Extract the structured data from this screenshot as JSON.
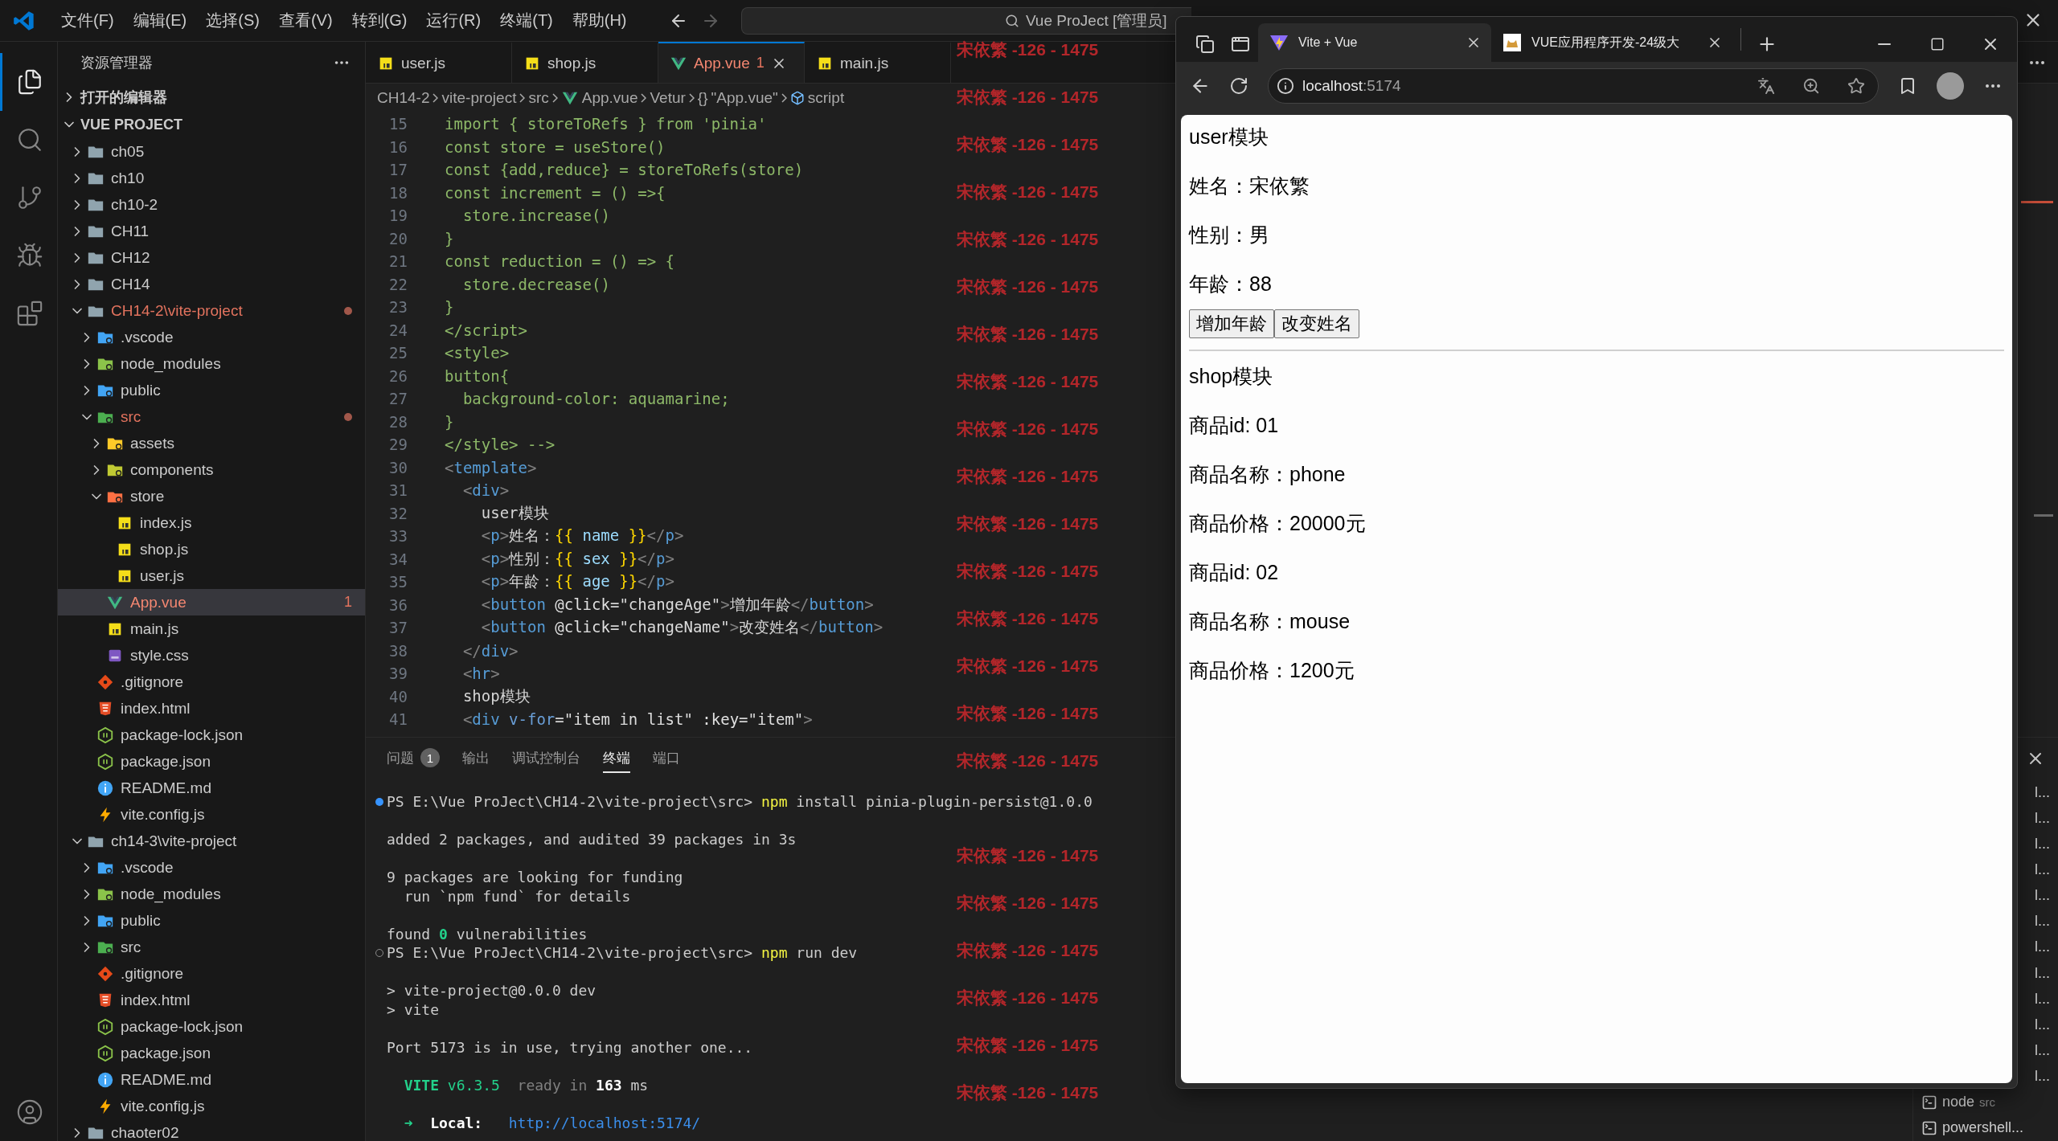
{
  "title_bar": {
    "menus": [
      "文件(F)",
      "编辑(E)",
      "选择(S)",
      "查看(V)",
      "转到(G)",
      "运行(R)",
      "终端(T)",
      "帮助(H)"
    ],
    "search": "Vue ProJect [管理员]"
  },
  "activity_bar": [
    {
      "kind": "explorer",
      "selected": true
    },
    {
      "kind": "search",
      "selected": false
    },
    {
      "kind": "source-control",
      "selected": false
    },
    {
      "kind": "run",
      "selected": false
    },
    {
      "kind": "extensions",
      "selected": false
    }
  ],
  "explorer": {
    "title": "资源管理器",
    "open_editors": "打开的编辑器",
    "root": "VUE PROJECT",
    "tree": [
      {
        "name": "ch05",
        "kind": "folder",
        "expanded": false,
        "modified": false,
        "error": false,
        "selected": false
      },
      {
        "name": "ch10",
        "kind": "folder",
        "expanded": false,
        "modified": false,
        "error": false,
        "selected": false
      },
      {
        "name": "ch10-2",
        "kind": "folder",
        "expanded": false,
        "modified": false,
        "error": false,
        "selected": false
      },
      {
        "name": "CH11",
        "kind": "folder",
        "expanded": false,
        "modified": false,
        "error": false,
        "selected": false
      },
      {
        "name": "CH12",
        "kind": "folder",
        "expanded": false,
        "modified": false,
        "error": false,
        "selected": false
      },
      {
        "name": "CH14",
        "kind": "folder",
        "expanded": false,
        "modified": false,
        "error": false,
        "selected": false
      },
      {
        "name": "CH14-2\\vite-project",
        "kind": "folder",
        "expanded": true,
        "modified": true,
        "error": false,
        "selected": false,
        "children": [
          {
            "name": ".vscode",
            "kind": "vscode",
            "expanded": false,
            "modified": false,
            "error": false,
            "selected": false
          },
          {
            "name": "node_modules",
            "kind": "node",
            "expanded": false,
            "modified": false,
            "error": false,
            "selected": false
          },
          {
            "name": "public",
            "kind": "public",
            "expanded": false,
            "modified": false,
            "error": false,
            "selected": false
          },
          {
            "name": "src",
            "kind": "src",
            "expanded": true,
            "modified": true,
            "error": false,
            "selected": false,
            "children": [
              {
                "name": "assets",
                "kind": "assets",
                "expanded": false,
                "modified": false,
                "error": false,
                "selected": false
              },
              {
                "name": "components",
                "kind": "components",
                "expanded": false,
                "modified": false,
                "error": false,
                "selected": false
              },
              {
                "name": "store",
                "kind": "store",
                "expanded": true,
                "modified": false,
                "error": false,
                "selected": false,
                "children": [
                  {
                    "name": "index.js",
                    "kind": "js",
                    "modified": false,
                    "error": false,
                    "selected": false
                  },
                  {
                    "name": "shop.js",
                    "kind": "js",
                    "modified": false,
                    "error": false,
                    "selected": false
                  },
                  {
                    "name": "user.js",
                    "kind": "js",
                    "modified": false,
                    "error": false,
                    "selected": false
                  }
                ]
              },
              {
                "name": "App.vue",
                "kind": "vue",
                "modified": false,
                "error": true,
                "selected": true,
                "badge": "1"
              },
              {
                "name": "main.js",
                "kind": "js",
                "modified": false,
                "error": false,
                "selected": false
              },
              {
                "name": "style.css",
                "kind": "css",
                "modified": false,
                "error": false,
                "selected": false
              }
            ]
          },
          {
            "name": ".gitignore",
            "kind": "git",
            "modified": false,
            "error": false,
            "selected": false
          },
          {
            "name": "index.html",
            "kind": "html",
            "modified": false,
            "error": false,
            "selected": false
          },
          {
            "name": "package-lock.json",
            "kind": "json",
            "modified": false,
            "error": false,
            "selected": false
          },
          {
            "name": "package.json",
            "kind": "json",
            "modified": false,
            "error": false,
            "selected": false
          },
          {
            "name": "README.md",
            "kind": "info",
            "modified": false,
            "error": false,
            "selected": false
          },
          {
            "name": "vite.config.js",
            "kind": "vite",
            "modified": false,
            "error": false,
            "selected": false
          }
        ]
      },
      {
        "name": "ch14-3\\vite-project",
        "kind": "folder",
        "expanded": true,
        "modified": false,
        "error": false,
        "selected": false,
        "children": [
          {
            "name": ".vscode",
            "kind": "vscode",
            "expanded": false,
            "modified": false,
            "error": false,
            "selected": false
          },
          {
            "name": "node_modules",
            "kind": "node",
            "expanded": false,
            "modified": false,
            "error": false,
            "selected": false
          },
          {
            "name": "public",
            "kind": "public",
            "expanded": false,
            "modified": false,
            "error": false,
            "selected": false
          },
          {
            "name": "src",
            "kind": "src",
            "expanded": false,
            "modified": false,
            "error": false,
            "selected": false
          },
          {
            "name": ".gitignore",
            "kind": "git",
            "modified": false,
            "error": false,
            "selected": false
          },
          {
            "name": "index.html",
            "kind": "html",
            "modified": false,
            "error": false,
            "selected": false
          },
          {
            "name": "package-lock.json",
            "kind": "json",
            "modified": false,
            "error": false,
            "selected": false
          },
          {
            "name": "package.json",
            "kind": "json",
            "modified": false,
            "error": false,
            "selected": false
          },
          {
            "name": "README.md",
            "kind": "info",
            "modified": false,
            "error": false,
            "selected": false
          },
          {
            "name": "vite.config.js",
            "kind": "vite",
            "modified": false,
            "error": false,
            "selected": false
          }
        ]
      },
      {
        "name": "chaoter02",
        "kind": "folder",
        "expanded": false,
        "modified": false,
        "error": false,
        "selected": false
      }
    ]
  },
  "editor_tabs": [
    {
      "label": "user.js",
      "kind": "js",
      "selected": false,
      "error": false
    },
    {
      "label": "shop.js",
      "kind": "js",
      "selected": false,
      "error": false
    },
    {
      "label": "App.vue",
      "kind": "vue",
      "selected": true,
      "error": true,
      "badge": "1"
    },
    {
      "label": "main.js",
      "kind": "js",
      "selected": false,
      "error": false
    }
  ],
  "breadcrumb": [
    {
      "label": "CH14-2",
      "kind": "plain"
    },
    {
      "label": "vite-project",
      "kind": "plain"
    },
    {
      "label": "src",
      "kind": "plain"
    },
    {
      "label": "App.vue",
      "kind": "vue"
    },
    {
      "label": "Vetur",
      "kind": "plain"
    },
    {
      "label": "\"App.vue\"",
      "kind": "object",
      "symbol": "{}"
    },
    {
      "label": "script",
      "kind": "module"
    }
  ],
  "code": [
    {
      "number": "15",
      "tokens": [
        {
          "text": "import { storeToRefs } from 'pinia'",
          "kind": "comment"
        }
      ]
    },
    {
      "number": "16",
      "tokens": [
        {
          "text": "const store = useStore()",
          "kind": "comment"
        }
      ]
    },
    {
      "number": "17",
      "tokens": [
        {
          "text": "const {add,reduce} = storeToRefs(store)",
          "kind": "comment"
        }
      ]
    },
    {
      "number": "18",
      "tokens": [
        {
          "text": "const increment = () =>{",
          "kind": "comment"
        }
      ]
    },
    {
      "number": "19",
      "tokens": [
        {
          "text": "  store.increase()",
          "kind": "comment"
        }
      ]
    },
    {
      "number": "20",
      "tokens": [
        {
          "text": "}",
          "kind": "comment"
        }
      ]
    },
    {
      "number": "21",
      "tokens": [
        {
          "text": "const reduction = () => {",
          "kind": "comment"
        }
      ]
    },
    {
      "number": "22",
      "tokens": [
        {
          "text": "  store.decrease()",
          "kind": "comment"
        }
      ]
    },
    {
      "number": "23",
      "tokens": [
        {
          "text": "}",
          "kind": "comment"
        }
      ]
    },
    {
      "number": "24",
      "tokens": [
        {
          "text": "</script>",
          "kind": "comment"
        }
      ]
    },
    {
      "number": "25",
      "tokens": [
        {
          "text": "<style>",
          "kind": "comment"
        }
      ]
    },
    {
      "number": "26",
      "tokens": [
        {
          "text": "button{",
          "kind": "comment"
        }
      ]
    },
    {
      "number": "27",
      "tokens": [
        {
          "text": "  background-color: aquamarine;",
          "kind": "comment"
        }
      ]
    },
    {
      "number": "28",
      "tokens": [
        {
          "text": "}",
          "kind": "comment"
        }
      ]
    },
    {
      "number": "29",
      "tokens": [
        {
          "text": "</style> -->",
          "kind": "comment"
        }
      ]
    },
    {
      "number": "30",
      "tokens": [
        {
          "text": "<",
          "kind": "punct"
        },
        {
          "text": "template",
          "kind": "tag"
        },
        {
          "text": ">",
          "kind": "punct"
        }
      ]
    },
    {
      "number": "31",
      "tokens": [
        {
          "text": "  <",
          "kind": "punct"
        },
        {
          "text": "div",
          "kind": "tag"
        },
        {
          "text": ">",
          "kind": "punct"
        }
      ]
    },
    {
      "number": "32",
      "tokens": [
        {
          "text": "    user模块",
          "kind": "text"
        }
      ]
    },
    {
      "number": "33",
      "tokens": [
        {
          "text": "    <",
          "kind": "punct"
        },
        {
          "text": "p",
          "kind": "tag"
        },
        {
          "text": ">",
          "kind": "punct"
        },
        {
          "text": "姓名：",
          "kind": "text"
        },
        {
          "text": "{{",
          "kind": "brace"
        },
        {
          "text": " name ",
          "kind": "var"
        },
        {
          "text": "}}",
          "kind": "brace"
        },
        {
          "text": "</",
          "kind": "punct"
        },
        {
          "text": "p",
          "kind": "tag"
        },
        {
          "text": ">",
          "kind": "punct"
        }
      ]
    },
    {
      "number": "34",
      "tokens": [
        {
          "text": "    <",
          "kind": "punct"
        },
        {
          "text": "p",
          "kind": "tag"
        },
        {
          "text": ">",
          "kind": "punct"
        },
        {
          "text": "性别：",
          "kind": "text"
        },
        {
          "text": "{{",
          "kind": "brace"
        },
        {
          "text": " sex ",
          "kind": "var"
        },
        {
          "text": "}}",
          "kind": "brace"
        },
        {
          "text": "</",
          "kind": "punct"
        },
        {
          "text": "p",
          "kind": "tag"
        },
        {
          "text": ">",
          "kind": "punct"
        }
      ]
    },
    {
      "number": "35",
      "tokens": [
        {
          "text": "    <",
          "kind": "punct"
        },
        {
          "text": "p",
          "kind": "tag"
        },
        {
          "text": ">",
          "kind": "punct"
        },
        {
          "text": "年龄：",
          "kind": "text"
        },
        {
          "text": "{{",
          "kind": "brace"
        },
        {
          "text": " age ",
          "kind": "var"
        },
        {
          "text": "}}",
          "kind": "brace"
        },
        {
          "text": "</",
          "kind": "punct"
        },
        {
          "text": "p",
          "kind": "tag"
        },
        {
          "text": ">",
          "kind": "punct"
        }
      ]
    },
    {
      "number": "36",
      "tokens": [
        {
          "text": "    <",
          "kind": "punct"
        },
        {
          "text": "button",
          "kind": "tag"
        },
        {
          "text": " @click",
          "kind": "attr"
        },
        {
          "text": "=",
          "kind": "text"
        },
        {
          "text": "\"changeAge\"",
          "kind": "string"
        },
        {
          "text": ">",
          "kind": "punct"
        },
        {
          "text": "增加年龄",
          "kind": "text"
        },
        {
          "text": "</",
          "kind": "punct"
        },
        {
          "text": "button",
          "kind": "tag"
        },
        {
          "text": ">",
          "kind": "punct"
        }
      ]
    },
    {
      "number": "37",
      "tokens": [
        {
          "text": "    <",
          "kind": "punct"
        },
        {
          "text": "button",
          "kind": "tag"
        },
        {
          "text": " @click",
          "kind": "attr"
        },
        {
          "text": "=",
          "kind": "text"
        },
        {
          "text": "\"changeName\"",
          "kind": "string"
        },
        {
          "text": ">",
          "kind": "punct"
        },
        {
          "text": "改变姓名",
          "kind": "text"
        },
        {
          "text": "</",
          "kind": "punct"
        },
        {
          "text": "button",
          "kind": "tag"
        },
        {
          "text": ">",
          "kind": "punct"
        }
      ]
    },
    {
      "number": "38",
      "tokens": [
        {
          "text": "  </",
          "kind": "punct"
        },
        {
          "text": "div",
          "kind": "tag"
        },
        {
          "text": ">",
          "kind": "punct"
        }
      ]
    },
    {
      "number": "39",
      "tokens": [
        {
          "text": "  <",
          "kind": "punct"
        },
        {
          "text": "hr",
          "kind": "tag"
        },
        {
          "text": ">",
          "kind": "punct"
        }
      ]
    },
    {
      "number": "40",
      "tokens": [
        {
          "text": "  shop模块",
          "kind": "text"
        }
      ]
    },
    {
      "number": "41",
      "tokens": [
        {
          "text": "  <",
          "kind": "punct"
        },
        {
          "text": "div",
          "kind": "tag"
        },
        {
          "text": " v-for",
          "kind": "directive"
        },
        {
          "text": "=",
          "kind": "text"
        },
        {
          "text": "\"item in list\"",
          "kind": "string"
        },
        {
          "text": " :key",
          "kind": "attr"
        },
        {
          "text": "=",
          "kind": "text"
        },
        {
          "text": "\"item\"",
          "kind": "string"
        },
        {
          "text": ">",
          "kind": "punct"
        }
      ]
    }
  ],
  "panel_tabs": [
    {
      "label": "问题",
      "selected": false,
      "badge": "1"
    },
    {
      "label": "输出",
      "selected": false
    },
    {
      "label": "调试控制台",
      "selected": false
    },
    {
      "label": "终端",
      "selected": true
    },
    {
      "label": "端口",
      "selected": false
    }
  ],
  "terminal": {
    "blocks": [
      {
        "lines": [
          {
            "prompt": true,
            "finished": true,
            "segments": [
              {
                "text": "PS E:\\Vue ProJect\\CH14-2\\vite-project\\src> ",
                "kind": "plain"
              },
              {
                "text": "npm",
                "kind": "cmd"
              },
              {
                "text": " install pinia-plugin-persist@1.0.0",
                "kind": "plain"
              }
            ]
          }
        ]
      },
      {
        "lines": [
          {
            "prompt": false,
            "segments": [
              {
                "text": "added 2 packages, and audited 39 packages in 3s",
                "kind": "plain"
              }
            ]
          }
        ]
      },
      {
        "lines": [
          {
            "prompt": false,
            "segments": [
              {
                "text": "9 packages are looking for funding",
                "kind": "plain"
              }
            ]
          },
          {
            "prompt": false,
            "segments": [
              {
                "text": "  run `npm fund` for details",
                "kind": "plain"
              }
            ]
          }
        ]
      },
      {
        "lines": [
          {
            "prompt": false,
            "segments": [
              {
                "text": "found ",
                "kind": "plain"
              },
              {
                "text": "0",
                "kind": "good"
              },
              {
                "text": " vulnerabilities",
                "kind": "plain"
              }
            ]
          },
          {
            "prompt": true,
            "finished": false,
            "segments": [
              {
                "text": "PS E:\\Vue ProJect\\CH14-2\\vite-project\\src> ",
                "kind": "plain"
              },
              {
                "text": "npm",
                "kind": "cmd"
              },
              {
                "text": " run dev",
                "kind": "plain"
              }
            ]
          }
        ]
      },
      {
        "lines": [
          {
            "prompt": false,
            "segments": [
              {
                "text": "> vite-project@0.0.0 dev",
                "kind": "plain"
              }
            ]
          },
          {
            "prompt": false,
            "segments": [
              {
                "text": "> vite",
                "kind": "plain"
              }
            ]
          }
        ]
      },
      {
        "lines": [
          {
            "prompt": false,
            "segments": [
              {
                "text": "Port 5173 is in use, trying another one...",
                "kind": "plain"
              }
            ]
          }
        ]
      },
      {
        "lines": [
          {
            "prompt": false,
            "segments": [
              {
                "text": "  VITE",
                "kind": "good"
              },
              {
                "text": " v6.3.5",
                "kind": "green"
              },
              {
                "text": "  ready in ",
                "kind": "dim"
              },
              {
                "text": "163",
                "kind": "bold"
              },
              {
                "text": " ms",
                "kind": "plain"
              }
            ]
          }
        ]
      },
      {
        "lines": [
          {
            "prompt": false,
            "segments": [
              {
                "text": "  ➜",
                "kind": "green"
              },
              {
                "text": "  Local:   ",
                "kind": "bold"
              },
              {
                "text": "http://localhost:5174/",
                "kind": "link"
              }
            ]
          }
        ]
      }
    ]
  },
  "terminal_sessions": [
    {
      "name": "l...",
      "kind": "cut"
    },
    {
      "name": "l...",
      "kind": "cut"
    },
    {
      "name": "l...",
      "kind": "cut"
    },
    {
      "name": "l...",
      "kind": "cut"
    },
    {
      "name": "l...",
      "kind": "cut"
    },
    {
      "name": "l...",
      "kind": "cut"
    },
    {
      "name": "l...",
      "kind": "cut"
    },
    {
      "name": "l...",
      "kind": "cut"
    },
    {
      "name": "l...",
      "kind": "cut"
    },
    {
      "name": "l...",
      "kind": "cut"
    },
    {
      "name": "l...",
      "kind": "cut"
    },
    {
      "name": "l...",
      "kind": "cut"
    },
    {
      "name": "node",
      "detail": "src",
      "kind": "full"
    },
    {
      "name": "powershell...",
      "kind": "full"
    }
  ],
  "screen_watermark": {
    "upper": [
      "宋依繁 -126 - 1475",
      "宋依繁 -126 - 1475",
      "宋依繁 -126 - 1475",
      "宋依繁 -126 - 1475",
      "宋依繁 -126 - 1475",
      "宋依繁 -126 - 1475",
      "宋依繁 -126 - 1475",
      "宋依繁 -126 - 1475",
      "宋依繁 -126 - 1475",
      "宋依繁 -126 - 1475",
      "宋依繁 -126 - 1475",
      "宋依繁 -126 - 1475",
      "宋依繁 -126 - 1475",
      "宋依繁 -126 - 1475",
      "宋依繁 -126 - 1475",
      "宋依繁 -126 - 1475"
    ],
    "lower": [
      "宋依繁 -126 - 1475",
      "宋依繁 -126 - 1475",
      "宋依繁 -126 - 1475",
      "宋依繁 -126 - 1475",
      "宋依繁 -126 - 1475",
      "宋依繁 -126 - 1475"
    ]
  },
  "browser": {
    "tabs": [
      {
        "title": "Vite + Vue",
        "kind": "vite",
        "selected": true
      },
      {
        "title": "VUE应用程序开发-24级大",
        "kind": "cat",
        "selected": false
      }
    ],
    "address": {
      "host": "localhost",
      "port": ":5174"
    },
    "page": {
      "sections": [
        {
          "title": "user模块",
          "fields": [
            "姓名：宋依繁",
            "性别：男",
            "年龄：88"
          ],
          "buttons": [
            "增加年龄",
            "改变姓名"
          ]
        },
        {
          "title": "shop模块",
          "fields": [
            "商品id: 01",
            "商品名称：phone",
            "商品价格：20000元",
            "商品id: 02",
            "商品名称：mouse",
            "商品价格：1200元"
          ]
        }
      ]
    }
  }
}
